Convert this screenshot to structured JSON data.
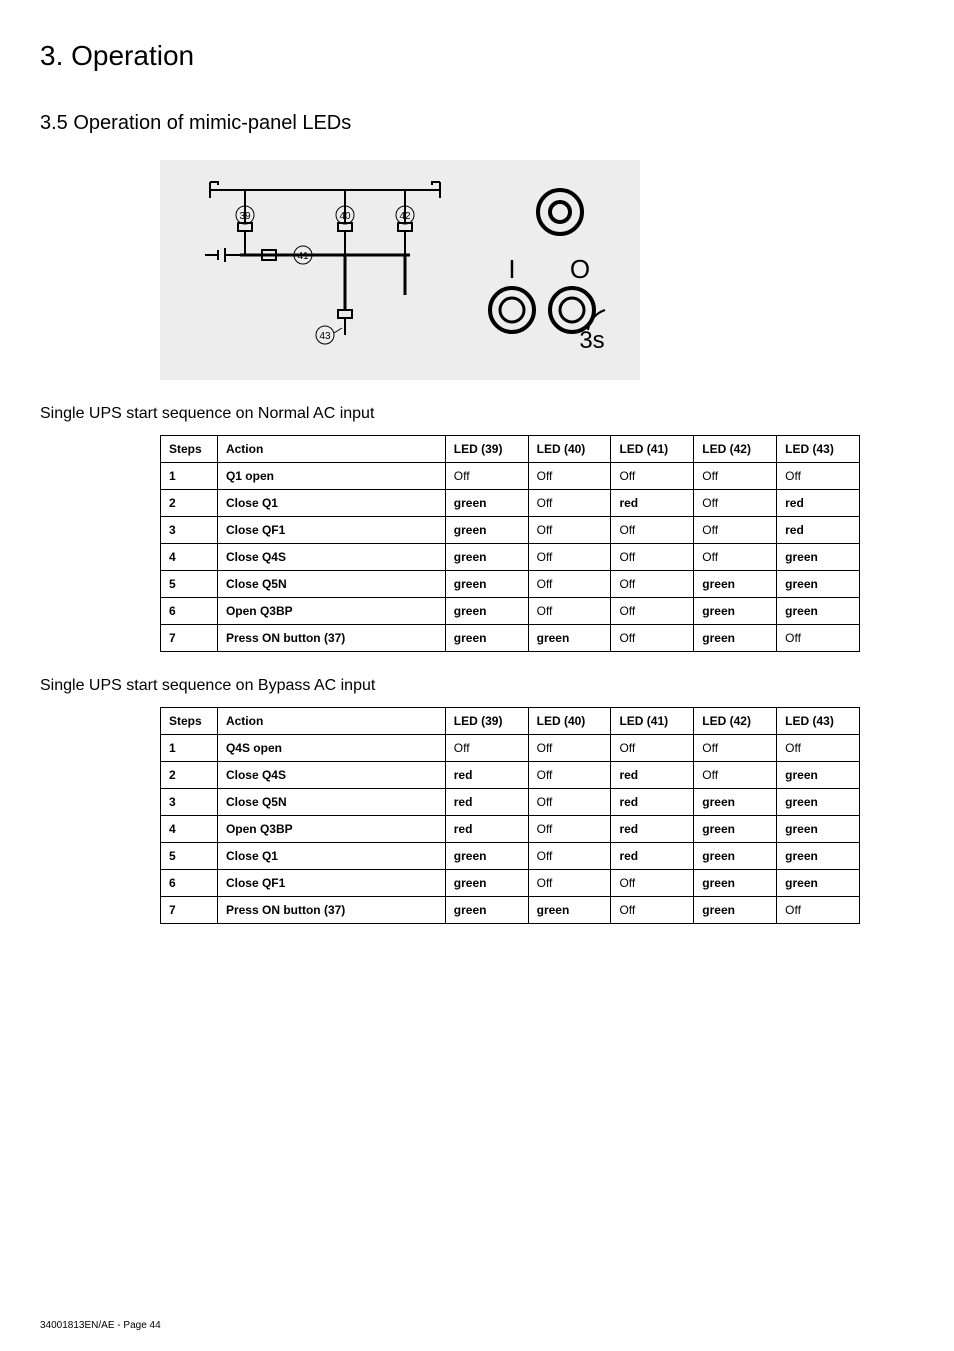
{
  "chapter": "3. Operation",
  "section": "3.5 Operation of mimic-panel LEDs",
  "diagram": {
    "labels": {
      "39": "39",
      "40": "40",
      "41": "41",
      "42": "42",
      "43": "43"
    },
    "button_i": "I",
    "button_o": "O",
    "button_hold": "3s"
  },
  "table1": {
    "title": "Single UPS start sequence on Normal AC input",
    "headers": [
      "Steps",
      "Action",
      "LED (39)",
      "LED (40)",
      "LED (41)",
      "LED (42)",
      "LED (43)"
    ],
    "rows": [
      {
        "step": "1",
        "action": "Q1 open",
        "led39": "Off",
        "led40": "Off",
        "led41": "Off",
        "led42": "Off",
        "led43": "Off",
        "bold": [
          "step",
          "action"
        ]
      },
      {
        "step": "2",
        "action": "Close Q1",
        "led39": "green",
        "led40": "Off",
        "led41": "red",
        "led42": "Off",
        "led43": "red",
        "bold": [
          "step",
          "action",
          "led39",
          "led41",
          "led43"
        ]
      },
      {
        "step": "3",
        "action": "Close QF1",
        "led39": "green",
        "led40": "Off",
        "led41": "Off",
        "led42": "Off",
        "led43": "red",
        "bold": [
          "step",
          "action",
          "led39",
          "led43"
        ]
      },
      {
        "step": "4",
        "action": "Close Q4S",
        "led39": "green",
        "led40": "Off",
        "led41": "Off",
        "led42": "Off",
        "led43": "green",
        "bold": [
          "step",
          "action",
          "led39",
          "led43"
        ]
      },
      {
        "step": "5",
        "action": "Close Q5N",
        "led39": "green",
        "led40": "Off",
        "led41": "Off",
        "led42": "green",
        "led43": "green",
        "bold": [
          "step",
          "action",
          "led39",
          "led42",
          "led43"
        ]
      },
      {
        "step": "6",
        "action": "Open Q3BP",
        "led39": "green",
        "led40": "Off",
        "led41": "Off",
        "led42": "green",
        "led43": "green",
        "bold": [
          "step",
          "action",
          "led39",
          "led42",
          "led43"
        ]
      },
      {
        "step": "7",
        "action": "Press ON button (37)",
        "led39": "green",
        "led40": "green",
        "led41": "Off",
        "led42": "green",
        "led43": "Off",
        "bold": [
          "step",
          "action",
          "led39",
          "led40",
          "led42"
        ]
      }
    ]
  },
  "table2": {
    "title": "Single UPS start sequence on Bypass AC input",
    "headers": [
      "Steps",
      "Action",
      "LED (39)",
      "LED (40)",
      "LED (41)",
      "LED (42)",
      "LED (43)"
    ],
    "rows": [
      {
        "step": "1",
        "action": "Q4S open",
        "led39": "Off",
        "led40": "Off",
        "led41": "Off",
        "led42": "Off",
        "led43": "Off",
        "bold": [
          "step",
          "action"
        ]
      },
      {
        "step": "2",
        "action": "Close Q4S",
        "led39": "red",
        "led40": "Off",
        "led41": "red",
        "led42": "Off",
        "led43": "green",
        "bold": [
          "step",
          "action",
          "led39",
          "led41",
          "led43"
        ]
      },
      {
        "step": "3",
        "action": "Close Q5N",
        "led39": "red",
        "led40": "Off",
        "led41": "red",
        "led42": "green",
        "led43": "green",
        "bold": [
          "step",
          "action",
          "led39",
          "led41",
          "led42",
          "led43"
        ]
      },
      {
        "step": "4",
        "action": "Open Q3BP",
        "led39": "red",
        "led40": "Off",
        "led41": "red",
        "led42": "green",
        "led43": "green",
        "bold": [
          "step",
          "action",
          "led39",
          "led41",
          "led42",
          "led43"
        ]
      },
      {
        "step": "5",
        "action": "Close Q1",
        "led39": "green",
        "led40": "Off",
        "led41": "red",
        "led42": "green",
        "led43": "green",
        "bold": [
          "step",
          "action",
          "led39",
          "led41",
          "led42",
          "led43"
        ]
      },
      {
        "step": "6",
        "action": "Close QF1",
        "led39": "green",
        "led40": "Off",
        "led41": "Off",
        "led42": "green",
        "led43": "green",
        "bold": [
          "step",
          "action",
          "led39",
          "led42",
          "led43"
        ]
      },
      {
        "step": "7",
        "action": "Press ON button (37)",
        "led39": "green",
        "led40": "green",
        "led41": "Off",
        "led42": "green",
        "led43": "Off",
        "bold": [
          "step",
          "action",
          "led39",
          "led40",
          "led42"
        ]
      }
    ]
  },
  "footer": {
    "doc": "34001813EN/AE",
    "page": " - Page 44"
  }
}
